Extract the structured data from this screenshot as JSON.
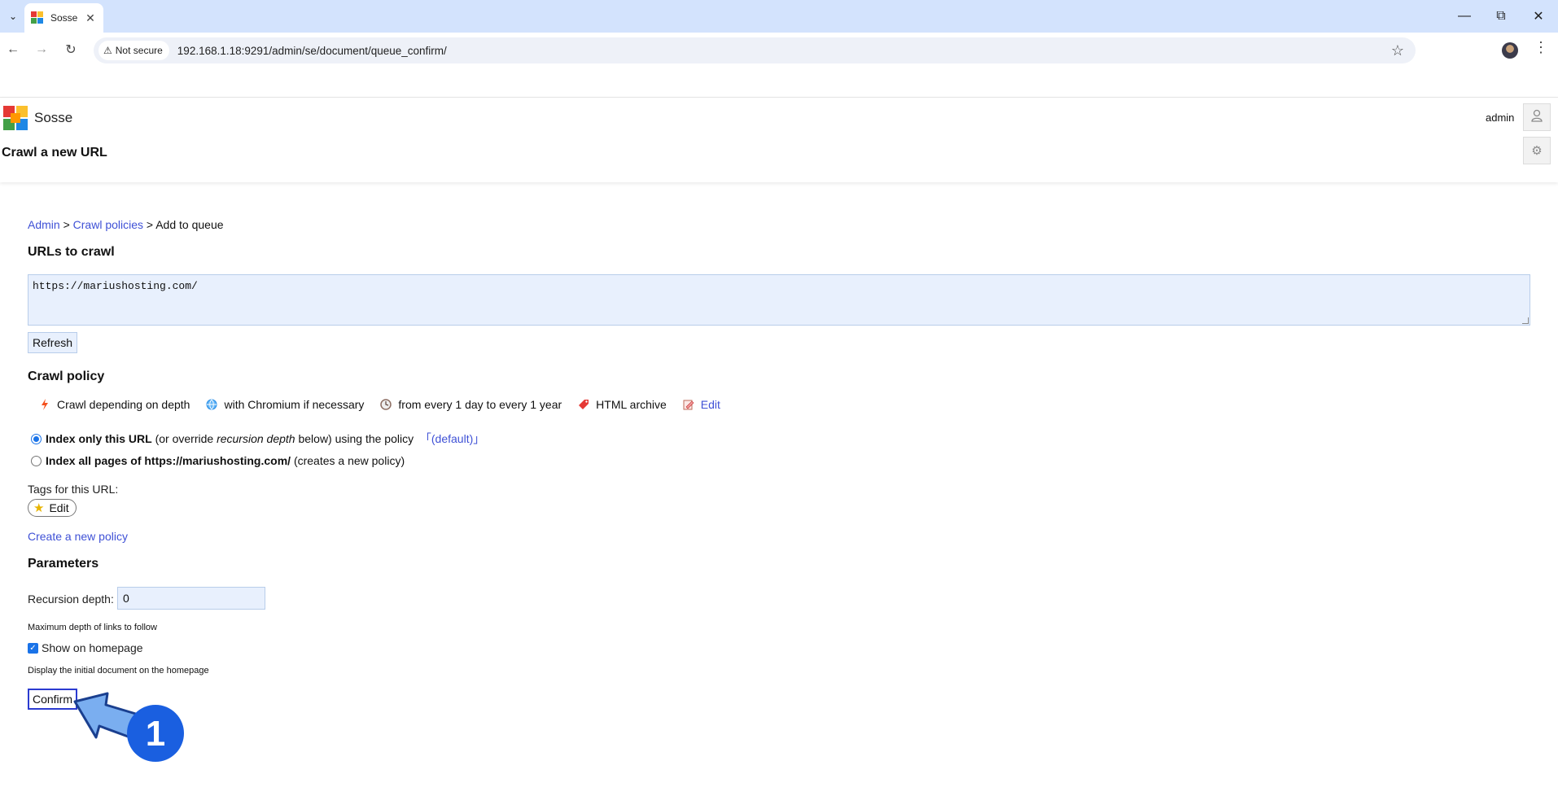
{
  "browser": {
    "tab_title": "Sosse",
    "security_label": "Not secure",
    "url": "192.168.1.18:9291/admin/se/document/queue_confirm/"
  },
  "header": {
    "brand": "Sosse",
    "subtitle": "Crawl a new URL",
    "username": "admin"
  },
  "breadcrumb": {
    "admin": "Admin",
    "sep1": ">",
    "crawl_policies": "Crawl policies",
    "sep2": ">",
    "current": "Add to queue"
  },
  "urls_section": {
    "heading": "URLs to crawl",
    "value": "https://mariushosting.com/",
    "refresh_label": "Refresh"
  },
  "crawl_policy": {
    "heading": "Crawl policy",
    "items": [
      {
        "icon": "lightning-icon",
        "label": "Crawl depending on depth"
      },
      {
        "icon": "globe-icon",
        "label": "with Chromium if necessary"
      },
      {
        "icon": "clock-icon",
        "label": "from every 1 day to every 1 year"
      },
      {
        "icon": "tag-icon",
        "label": "HTML archive"
      }
    ],
    "edit_label": "Edit",
    "option1_bold": "Index only this URL",
    "option1_mid": "(or override",
    "option1_italic": "recursion depth",
    "option1_rest": "below) using the policy",
    "option1_policy": "「(default)」",
    "option2_bold": "Index all pages of https://mariushosting.com/",
    "option2_rest": "(creates a new policy)",
    "tags_label": "Tags for this URL:",
    "tags_edit": "Edit",
    "create_policy": "Create a new policy"
  },
  "parameters": {
    "heading": "Parameters",
    "recursion_label": "Recursion depth:",
    "recursion_value": "0",
    "recursion_help": "Maximum depth of links to follow",
    "show_home_label": "Show on homepage",
    "show_home_help": "Display the initial document on the homepage",
    "confirm_label": "Confirm"
  },
  "annotation": {
    "step_number": "1",
    "color": "#1a5fe0"
  }
}
